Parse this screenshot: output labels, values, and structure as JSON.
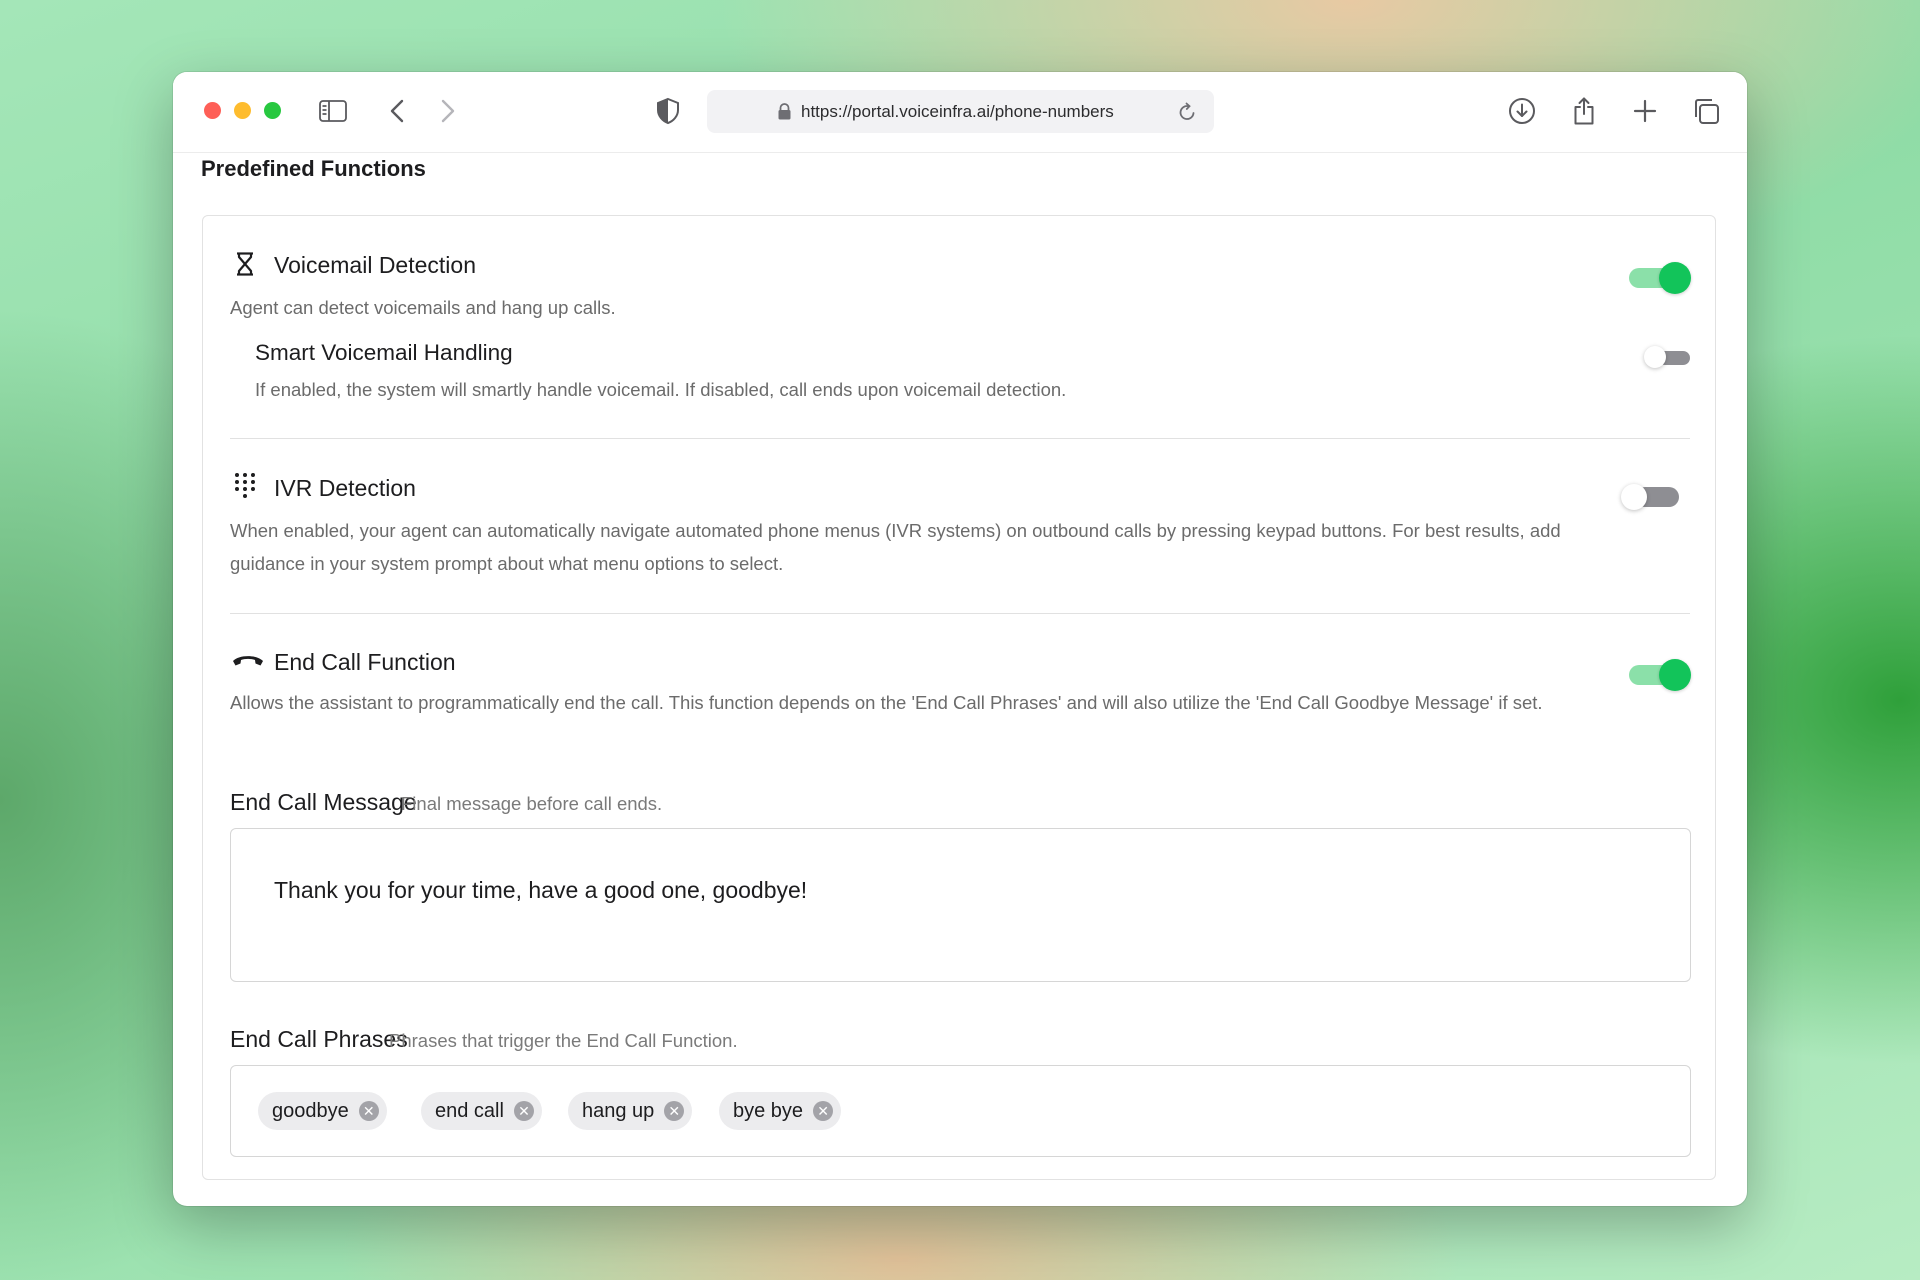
{
  "browser": {
    "url": "https://portal.voiceinfra.ai/phone-numbers"
  },
  "page": {
    "section_title": "Predefined Functions"
  },
  "functions": {
    "voicemail": {
      "title": "Voicemail Detection",
      "description": "Agent can detect voicemails and hang up calls.",
      "enabled": true,
      "icon": "hourglass-icon",
      "sub": {
        "title": "Smart Voicemail Handling",
        "description": "If enabled, the system will smartly handle voicemail. If disabled, call ends upon voicemail detection.",
        "enabled": false
      }
    },
    "ivr": {
      "title": "IVR Detection",
      "description": "When enabled, your agent can automatically navigate automated phone menus (IVR systems) on outbound calls by pressing keypad buttons. For best results, add guidance in your system prompt about what menu options to select.",
      "enabled": false,
      "icon": "keypad-icon"
    },
    "end_call": {
      "title": "End Call Function",
      "description": "Allows the assistant to programmatically end the call. This function depends on the 'End Call Phrases' and will also utilize the 'End Call Goodbye Message' if set.",
      "enabled": true,
      "icon": "phone-hangup-icon"
    }
  },
  "end_call_message": {
    "label": "End Call Message",
    "hint": "Final message before call ends.",
    "value": "Thank you for your time, have a good one, goodbye!"
  },
  "end_call_phrases": {
    "label": "End Call Phrases",
    "hint": "Phrases that trigger the End Call Function.",
    "items": [
      "goodbye",
      "end call",
      "hang up",
      "bye bye"
    ]
  },
  "colors": {
    "toggle_on": "#12c45a",
    "toggle_track_on": "#8be0a9",
    "toggle_off": "#8e8e93"
  }
}
